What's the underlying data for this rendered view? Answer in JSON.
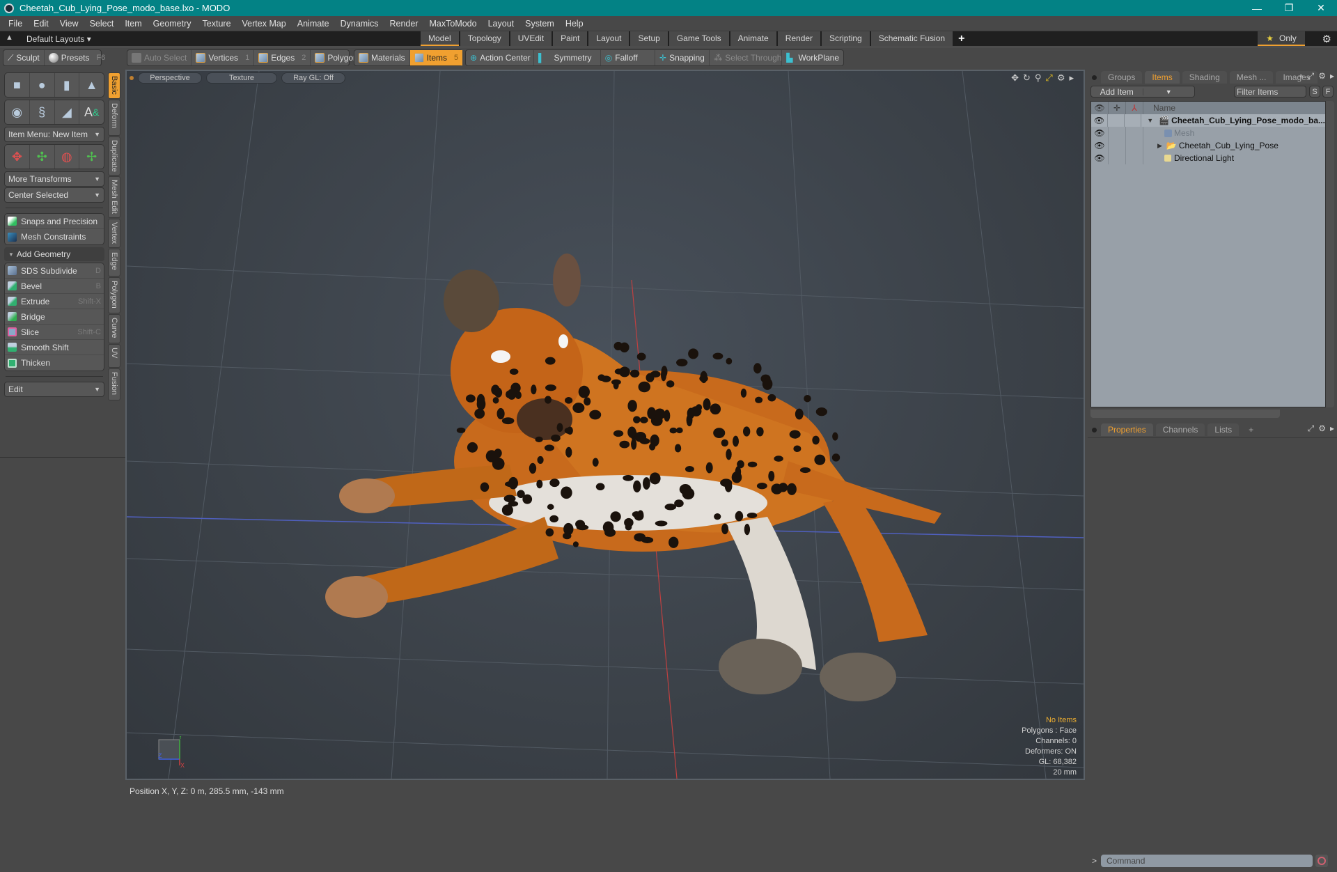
{
  "window": {
    "title": "Cheetah_Cub_Lying_Pose_modo_base.lxo - MODO",
    "controls": {
      "minimize": "—",
      "restore": "❐",
      "close": "✕"
    }
  },
  "menu": [
    "File",
    "Edit",
    "View",
    "Select",
    "Item",
    "Geometry",
    "Texture",
    "Vertex Map",
    "Animate",
    "Dynamics",
    "Render",
    "MaxToModo",
    "Layout",
    "System",
    "Help"
  ],
  "layoutbar": {
    "layouts_label": "Default Layouts ▾",
    "tabs": [
      "Model",
      "Topology",
      "UVEdit",
      "Paint",
      "Layout",
      "Setup",
      "Game Tools",
      "Animate",
      "Render",
      "Scripting",
      "Schematic Fusion"
    ],
    "active_tab": "Model",
    "add_tab": "+",
    "only_label": "Only",
    "star": "★",
    "gear": "⚙"
  },
  "toolbar": {
    "sculpt": "Sculpt",
    "presets": "Presets",
    "presets_key": "F6",
    "auto_select": "Auto Select",
    "vertices": "Vertices",
    "vertices_key": "1",
    "edges": "Edges",
    "edges_key": "2",
    "polygons": "Polygons",
    "materials": "Materials",
    "items": "Items",
    "items_key": "5",
    "action_center": "Action Center",
    "symmetry": "Symmetry",
    "falloff": "Falloff",
    "snapping": "Snapping",
    "select_through": "Select Through",
    "workplane": "WorkPlane"
  },
  "leftpanel": {
    "item_menu": "Item Menu: New Item",
    "more_transforms": "More Transforms",
    "center_selected": "Center Selected",
    "snaps": "Snaps and Precision",
    "mesh_constraints": "Mesh Constraints",
    "add_geometry": "Add Geometry",
    "tools": [
      {
        "label": "SDS Subdivide",
        "shortcut": "D"
      },
      {
        "label": "Bevel",
        "shortcut": "B"
      },
      {
        "label": "Extrude",
        "shortcut": "Shift-X"
      },
      {
        "label": "Bridge",
        "shortcut": ""
      },
      {
        "label": "Slice",
        "shortcut": "Shift-C"
      },
      {
        "label": "Smooth Shift",
        "shortcut": ""
      },
      {
        "label": "Thicken",
        "shortcut": ""
      }
    ],
    "edit": "Edit",
    "vtabs": [
      "Basic",
      "Deform",
      "Duplicate",
      "Mesh Edit",
      "Vertex",
      "Edge",
      "Polygon",
      "Curve",
      "UV",
      "Fusion"
    ],
    "active_vtab": "Basic"
  },
  "viewport": {
    "view": "Perspective",
    "shading": "Texture",
    "raygl": "Ray GL: Off",
    "hud": {
      "selection": "No Items",
      "mode": "Polygons : Face",
      "channels": "Channels: 0",
      "deformers": "Deformers: ON",
      "gl": "GL: 68,382",
      "scale": "20 mm"
    },
    "axis_labels": {
      "x": "X",
      "y": "Y",
      "z": "Z"
    }
  },
  "status": {
    "position": "Position X, Y, Z:   0 m, 285.5 mm, -143 mm"
  },
  "rightpanel": {
    "tabs": [
      "Groups",
      "Items",
      "Shading",
      "Mesh ...",
      "Images"
    ],
    "active_tab": "Items",
    "add_item": "Add Item",
    "filter_placeholder": "Filter Items",
    "s_btn": "S",
    "f_btn": "F",
    "name_header": "Name",
    "tree": [
      {
        "label": "Cheetah_Cub_Lying_Pose_modo_ba...",
        "indent": 0,
        "expander": "▼",
        "icon": "scene-icon",
        "bold": true,
        "dim": false
      },
      {
        "label": "Mesh",
        "indent": 1,
        "expander": "",
        "icon": "mesh-icon",
        "bold": false,
        "dim": true
      },
      {
        "label": "Cheetah_Cub_Lying_Pose",
        "indent": 1,
        "expander": "▶",
        "icon": "group-icon",
        "bold": false,
        "dim": false
      },
      {
        "label": "Directional Light",
        "indent": 1,
        "expander": "",
        "icon": "light-icon",
        "bold": false,
        "dim": false
      }
    ],
    "props_tabs": [
      "Properties",
      "Channels",
      "Lists"
    ],
    "active_props_tab": "Properties",
    "props_add": "+",
    "command_placeholder": "Command",
    "command_prompt": ">"
  },
  "colors": {
    "accent": "#f0a030",
    "titlebar": "#038285",
    "panel": "#484848",
    "tree_bg": "#98a0a8"
  }
}
